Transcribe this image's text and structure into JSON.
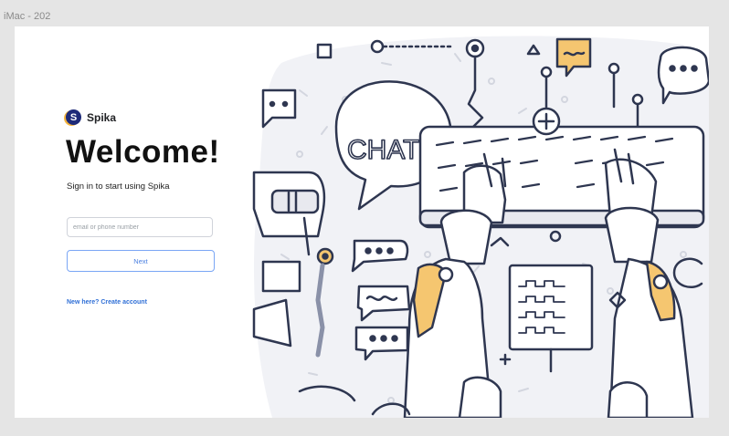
{
  "canvas": {
    "frame_label": "iMac - 202"
  },
  "brand": {
    "logo_letter": "S",
    "name": "Spika",
    "accent": "#f3b33d",
    "primary": "#1e2a78"
  },
  "login": {
    "title": "Welcome!",
    "subtitle": "Sign in to start using Spika",
    "input_placeholder": "email or phone number",
    "input_value": "",
    "next_label": "Next",
    "create_account_label": "New here? Create account"
  },
  "illustration": {
    "bubble_text": "CHAT",
    "icons": [
      "robot-icon",
      "keyboard-icon",
      "chat-bubble-icon",
      "plus-icon"
    ]
  }
}
